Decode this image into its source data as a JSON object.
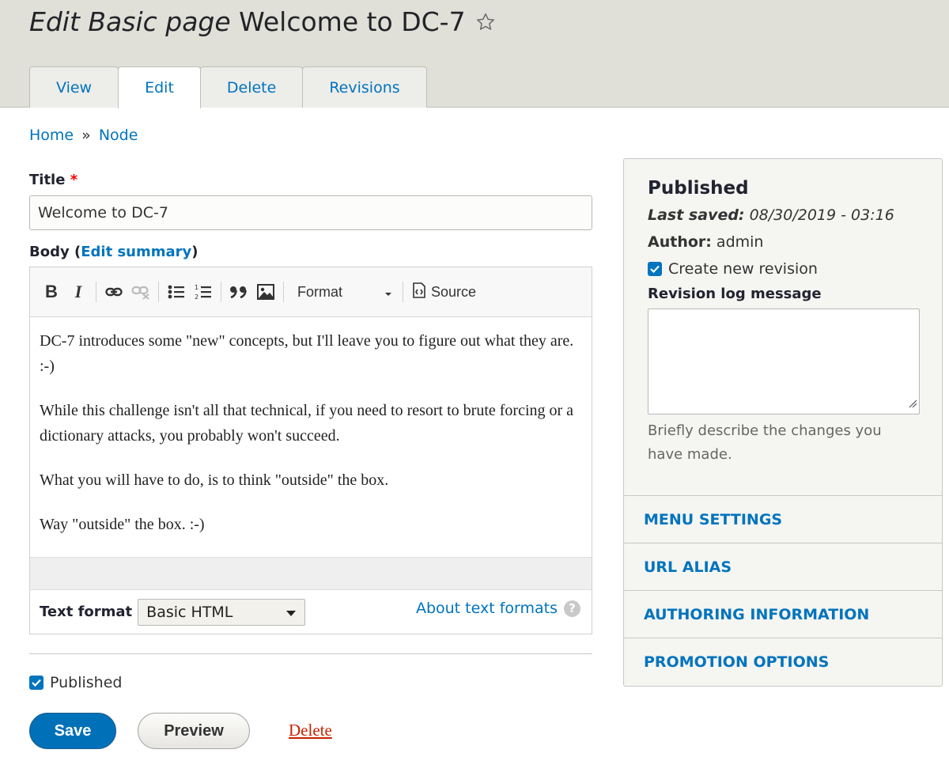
{
  "header": {
    "title_prefix": "Edit Basic page",
    "title_main": "Welcome to DC-7",
    "tabs": [
      {
        "label": "View"
      },
      {
        "label": "Edit"
      },
      {
        "label": "Delete"
      },
      {
        "label": "Revisions"
      }
    ],
    "active_tab": "Edit"
  },
  "breadcrumb": {
    "items": [
      "Home",
      "Node"
    ],
    "separator": "»"
  },
  "form": {
    "title_label": "Title",
    "required_mark": "*",
    "title_value": "Welcome to DC-7",
    "body_label": "Body",
    "body_paren_open": "(",
    "body_paren_close": ")",
    "edit_summary_link": "Edit summary",
    "toolbar": {
      "bold": "B",
      "italic": "I",
      "format_label": "Format",
      "source_label": "Source",
      "icons": [
        "bold-icon",
        "italic-icon",
        "link-icon",
        "unlink-icon",
        "bulleted-list-icon",
        "numbered-list-icon",
        "blockquote-icon",
        "image-icon",
        "source-icon"
      ]
    },
    "body_paragraphs": [
      "DC-7 introduces some \"new\" concepts, but I'll leave you to figure out what they are.  :-)",
      "While this challenge isn't all that technical, if you need to resort to brute forcing or a dictionary attacks, you probably won't succeed.",
      "What you will have to do, is to think \"outside\" the box.",
      "Way \"outside\" the box.  :-)"
    ],
    "text_format_label": "Text format",
    "text_format_value": "Basic HTML",
    "about_text_formats": "About text formats",
    "help_glyph": "?",
    "published_label": "Published",
    "published_checked": true
  },
  "actions": {
    "save": "Save",
    "preview": "Preview",
    "delete": "Delete"
  },
  "sidebar": {
    "status": "Published",
    "last_saved_label": "Last saved:",
    "last_saved_value": "08/30/2019 - 03:16",
    "author_label": "Author:",
    "author_value": "admin",
    "create_revision_label": "Create new revision",
    "create_revision_checked": true,
    "revision_log_label": "Revision log message",
    "revision_log_value": "",
    "revision_log_description": "Briefly describe the changes you have made.",
    "sections": [
      "Menu settings",
      "URL alias",
      "Authoring information",
      "Promotion options"
    ]
  },
  "colors": {
    "link": "#0074bd",
    "primary_button": "#0071b8",
    "danger_link": "#c72100",
    "header_bg": "#e0e0d8"
  }
}
